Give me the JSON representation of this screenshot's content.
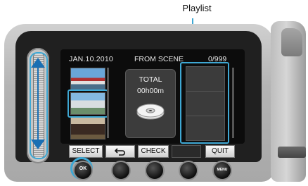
{
  "callout": {
    "label": "Playlist"
  },
  "screen": {
    "date": "JAN.10.2010",
    "source": "FROM SCENE",
    "counter": "0/999",
    "total_label": "TOTAL",
    "total_time": "00h00m"
  },
  "softkeys": {
    "select": "SELECT",
    "back_icon": "return-arrow-icon",
    "check": "CHECK",
    "blank": "",
    "quit": "QUIT"
  },
  "buttons": {
    "ok": "OK",
    "menu": "MENU"
  },
  "colors": {
    "highlight": "#3ea8d4",
    "slider_arrow": "#1a6fb3"
  },
  "icons": {
    "slider": "scroll-slider-icon",
    "disc": "disc-icon"
  }
}
